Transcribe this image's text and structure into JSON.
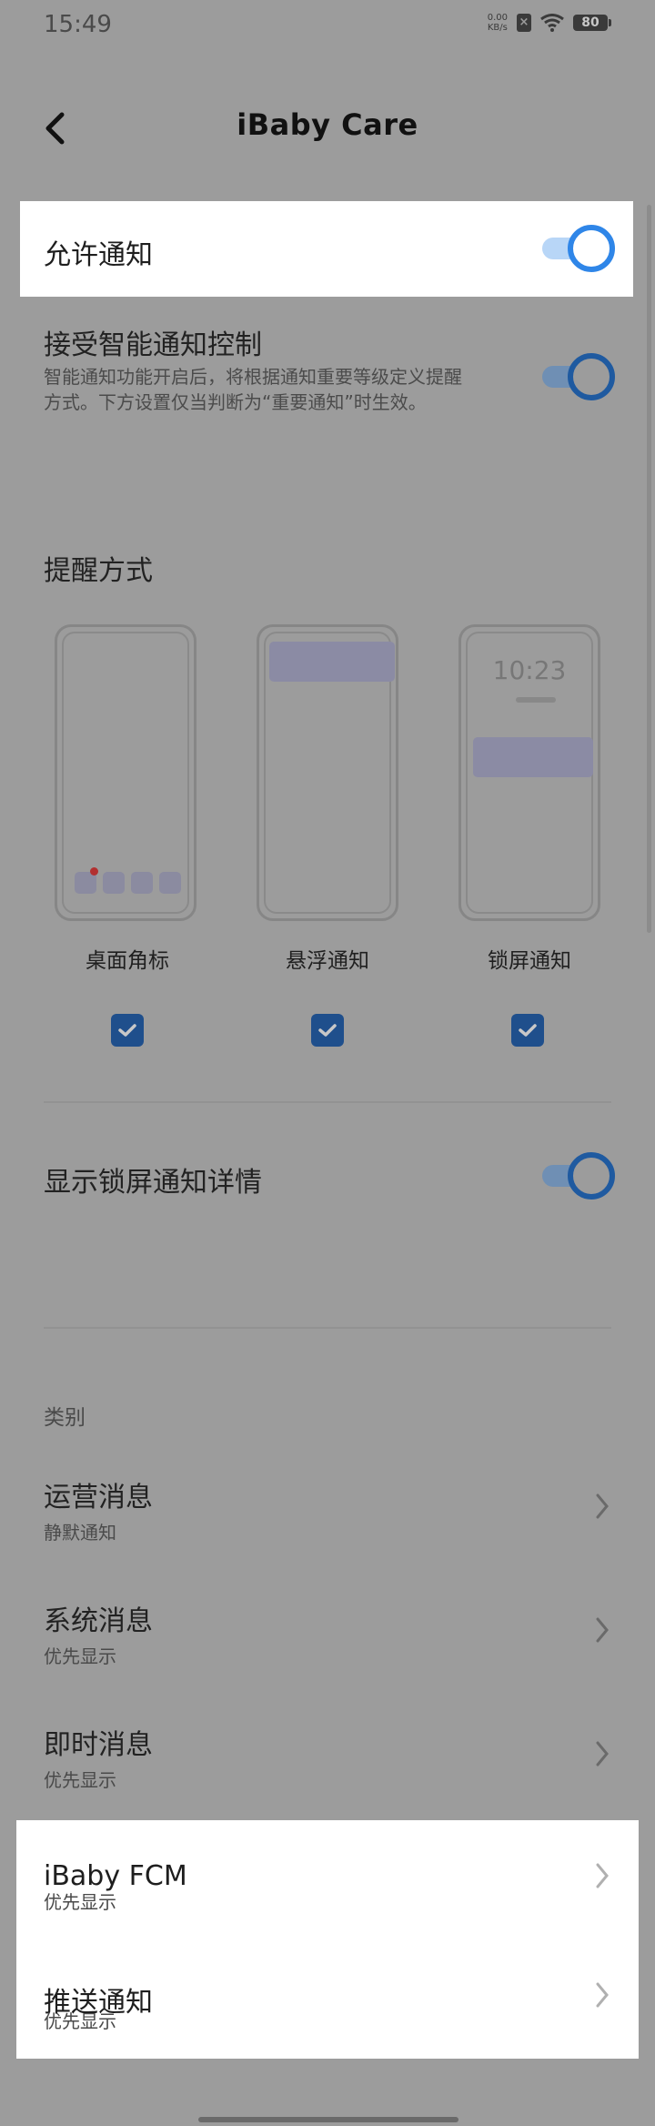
{
  "status_bar": {
    "time": "15:49",
    "net_speed_value": "0.00",
    "net_speed_unit": "KB/s",
    "battery": "80"
  },
  "header": {
    "title": "iBaby Care"
  },
  "settings": {
    "allow_notifications": {
      "label": "允许通知",
      "on": true
    },
    "smart_control": {
      "label": "接受智能通知控制",
      "description": "智能通知功能开启后，将根据通知重要等级定义提醒方式。下方设置仅当判断为“重要通知”时生效。",
      "on": true
    },
    "reminder_section": "提醒方式",
    "reminder_modes": [
      {
        "label": "桌面角标",
        "checked": true
      },
      {
        "label": "悬浮通知",
        "checked": true
      },
      {
        "label": "锁屏通知",
        "checked": true
      }
    ],
    "lock_preview_time": "10:23",
    "lock_details": {
      "label": "显示锁屏通知详情",
      "on": true
    }
  },
  "categories": {
    "section_label": "类别",
    "items": [
      {
        "title": "运营消息",
        "subtitle": "静默通知"
      },
      {
        "title": "系统消息",
        "subtitle": "优先显示"
      },
      {
        "title": "即时消息",
        "subtitle": "优先显示"
      },
      {
        "title": "iBaby FCM",
        "subtitle": "优先显示"
      },
      {
        "title": "推送通知",
        "subtitle": "优先显示"
      }
    ]
  },
  "colors": {
    "dim_background": "#9c9c9c",
    "highlight": "#ffffff",
    "toggle_accent": "#2f86e8",
    "checkbox": "#1f4f8c"
  }
}
